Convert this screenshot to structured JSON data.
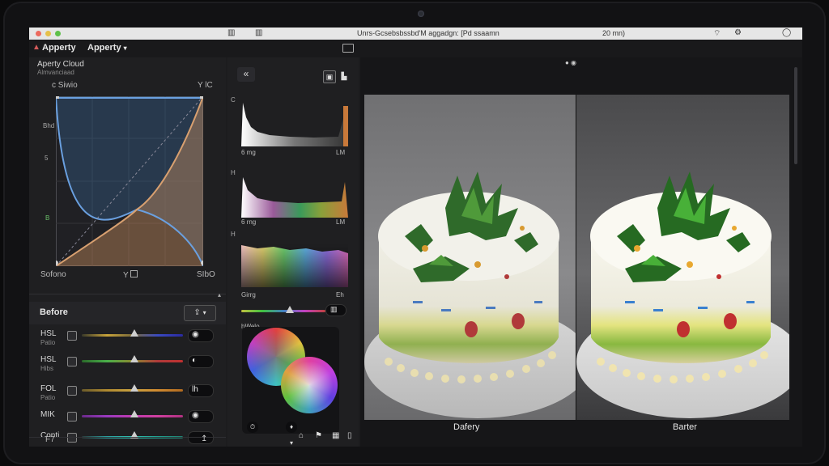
{
  "menubar": {
    "title": "Unrs-Gcsebsbssbd'M aggadgn: [Pd ssaamn",
    "time": "20 mn)",
    "icons": [
      "wifi-icon",
      "settings-icon",
      "battery-icon"
    ]
  },
  "topbar": {
    "app_name": "Apperty",
    "menu_label": "Apperty",
    "right_icon": "panel-icon"
  },
  "left_panel": {
    "section_title": "Aperty Cloud",
    "section_sub": "Almvanciaad",
    "curve_top_left": "c Siwio",
    "curve_top_right": "Y lC",
    "axis_left_top": "Bhd",
    "axis_left_mid": "5",
    "axis_left_bot": "B",
    "curve_bottom_left": "Sofono",
    "curve_bottom_mid": "Y",
    "curve_bottom_right": "SIbO",
    "before_label": "Before",
    "footer_left": "F7",
    "rows": [
      {
        "label": "HSL",
        "sub": "Patio",
        "glyph": "◉",
        "value": 0.52,
        "gradient": "linear-gradient(90deg,#3a3a2a,#c7a23a,#7a6a3a,#3a4ac0,#2a2aa0)"
      },
      {
        "label": "HSL",
        "sub": "Hibs",
        "glyph": "◐",
        "value": 0.52,
        "gradient": "linear-gradient(90deg,#2a6a2a,#4ab04a,#8a8a30,#b03a3a,#c03030)"
      },
      {
        "label": "FOL",
        "sub": "Patio",
        "glyph": "lh",
        "value": 0.52,
        "gradient": "linear-gradient(90deg,#6a5a2a,#b08a30,#c8a040,#d08a30,#b06a20)"
      },
      {
        "label": "MIK",
        "sub": "",
        "glyph": "◉",
        "value": 0.52,
        "gradient": "linear-gradient(90deg,#6a2a8a,#9a3ac0,#c03ab0,#d040a0,#b03080)"
      },
      {
        "label": "Conti",
        "sub": "",
        "glyph": "",
        "value": 0.52,
        "gradient": "linear-gradient(90deg,#2a3a3a,#2aa0a0,#30c0b0,#20a090,#208070)"
      }
    ]
  },
  "mid_panel": {
    "back_label": "«",
    "hist1": {
      "side": "C",
      "left": "6 mg",
      "right": "LM"
    },
    "hist2": {
      "side": "H",
      "left": "6 rng",
      "right": "LM"
    },
    "hist3": {
      "side": "H",
      "left": "Girrg",
      "right": "Eh"
    },
    "color_label": "hWelo",
    "footer_icons": [
      "tag-icon",
      "flag-icon",
      "grid-icon",
      "lock-icon"
    ]
  },
  "viewer": {
    "top_indicator": "● ◉",
    "left_caption": "Dafery",
    "right_caption": "Barter"
  },
  "colors": {
    "accent": "#c8793a",
    "curve_blue": "#6aa0e0",
    "curve_orange": "#d8a070"
  }
}
